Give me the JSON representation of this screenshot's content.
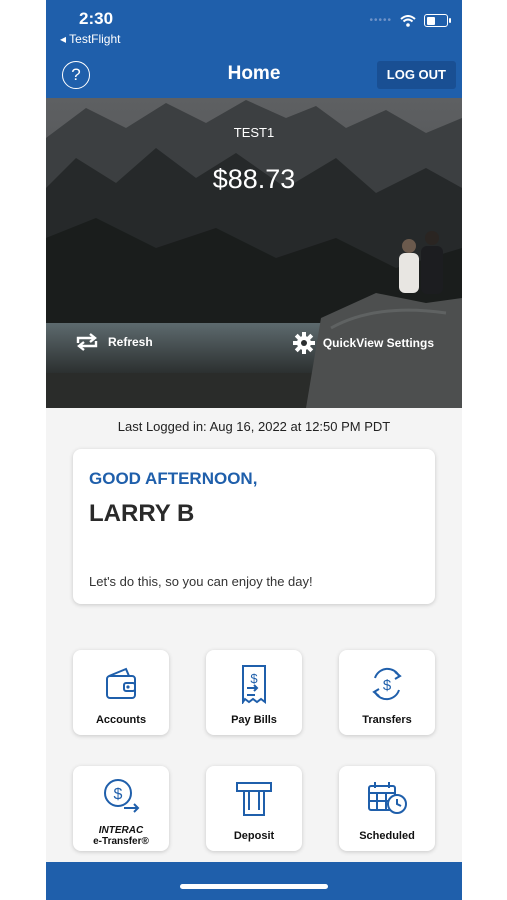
{
  "status": {
    "time": "2:30",
    "back_label": "◂ TestFlight"
  },
  "header": {
    "title": "Home",
    "help_icon": "?",
    "logout_label": "LOG OUT"
  },
  "hero": {
    "account_name": "TEST1",
    "balance": "$88.73",
    "refresh_label": "Refresh",
    "quickview_label": "QuickView Settings"
  },
  "last_login": "Last Logged in: Aug 16, 2022 at 12:50 PM  PDT",
  "greeting": {
    "label": "GOOD AFTERNOON,",
    "name": "LARRY B",
    "message": "Let's do this, so you can enjoy the day!"
  },
  "tiles": [
    {
      "label": "Accounts",
      "icon": "wallet-icon"
    },
    {
      "label": "Pay Bills",
      "icon": "bill-icon"
    },
    {
      "label": "Transfers",
      "icon": "transfer-icon"
    },
    {
      "label_line1": "INTERAC",
      "label_line2": "e-Transfer®",
      "icon": "etransfer-icon"
    },
    {
      "label": "Deposit",
      "icon": "atm-icon"
    },
    {
      "label": "Scheduled",
      "icon": "calendar-clock-icon"
    }
  ],
  "colors": {
    "brand_blue": "#1f5fab",
    "dark_blue": "#194f93",
    "background": "#f4f4f4"
  }
}
